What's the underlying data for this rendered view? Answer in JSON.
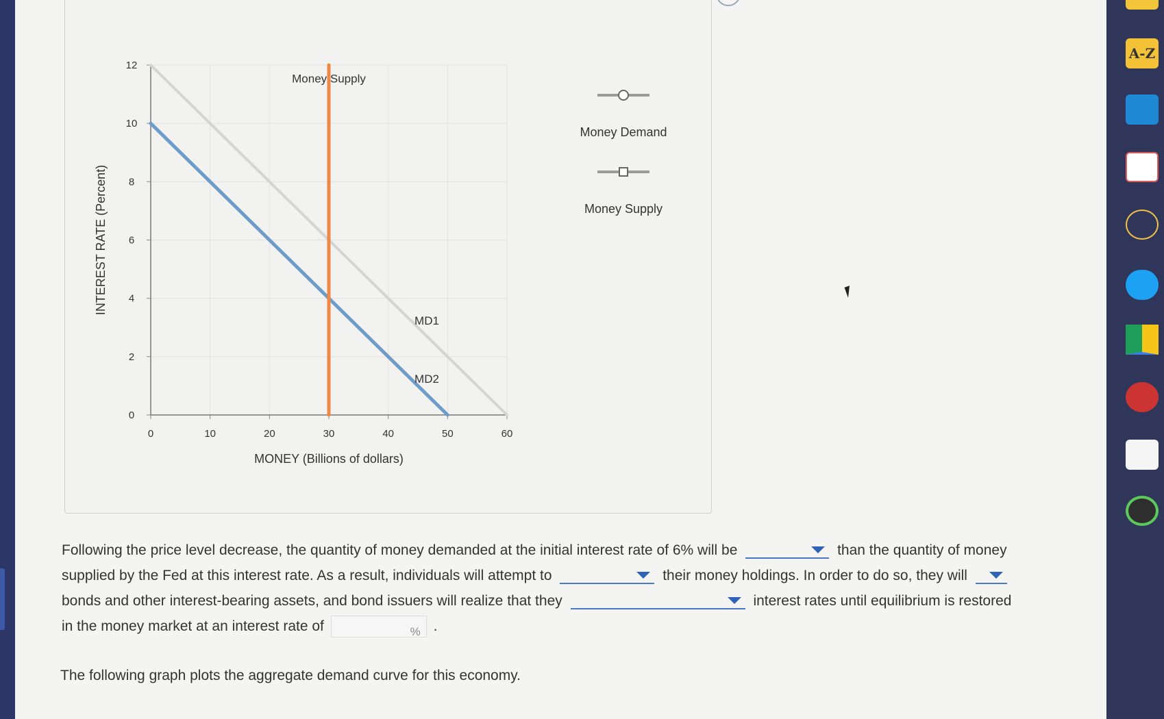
{
  "chart_data": {
    "type": "line",
    "xlabel": "MONEY (Billions of dollars)",
    "ylabel": "INTEREST RATE (Percent)",
    "xlim": [
      0,
      60
    ],
    "ylim": [
      0,
      12
    ],
    "xticks": [
      0,
      10,
      20,
      30,
      40,
      50,
      60
    ],
    "yticks": [
      0,
      2,
      4,
      6,
      8,
      10,
      12
    ],
    "grid": true,
    "series": [
      {
        "name": "MD1",
        "color": "#d4d4d4",
        "x": [
          0,
          60
        ],
        "y": [
          12,
          0
        ]
      },
      {
        "name": "MD2",
        "color": "#6d9cc9",
        "x": [
          0,
          50
        ],
        "y": [
          10,
          0
        ]
      },
      {
        "name": "Money Supply",
        "color": "#f08844",
        "x": [
          30,
          30
        ],
        "y": [
          0,
          12
        ]
      }
    ],
    "legend": {
      "placement": "right",
      "items": [
        {
          "label": "Money Demand",
          "marker": "circle"
        },
        {
          "label": "Money Supply",
          "marker": "square"
        }
      ]
    }
  },
  "question": {
    "line1_a": "Following the price level decrease, the quantity of money demanded at the initial interest rate of 6% will be",
    "line1_b": "than the quantity of money",
    "line2_a": "supplied by the Fed at this interest rate. As a result, individuals will attempt to",
    "line2_b": "their money holdings. In order to do so, they will",
    "line3_a": "bonds and other interest-bearing assets, and bond issuers will realize that they",
    "line3_b": "interest rates until equilibrium is restored",
    "line4_a": "in the money market at an interest rate of",
    "percent_unit": "%",
    "line4_end": "."
  },
  "followup_text": "The following graph plots the aggregate demand curve for this economy.",
  "sidebar": {
    "az_label": "A-Z"
  }
}
